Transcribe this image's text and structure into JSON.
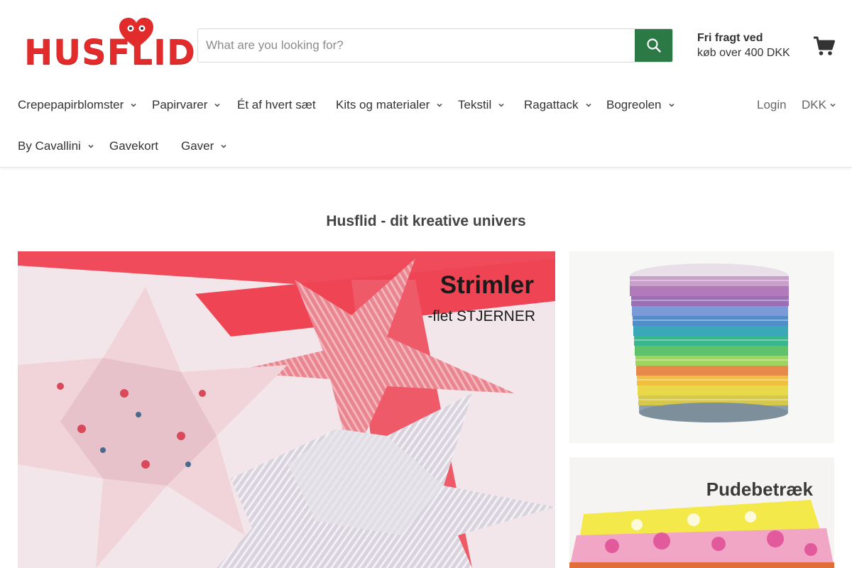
{
  "brand": {
    "logo_text": "HUSFLID",
    "colors": {
      "logo_red": "#e22b2b",
      "accent_green": "#2b7a45"
    }
  },
  "search": {
    "placeholder": "What are you looking for?",
    "value": "",
    "icon": "search-icon"
  },
  "shipping": {
    "title": "Fri fragt ved",
    "subtitle": "køb over 400 DKK"
  },
  "cart": {
    "icon": "cart-icon"
  },
  "nav": {
    "row1": [
      {
        "label": "Crepepapirblomster",
        "has_dropdown": true
      },
      {
        "label": "Papirvarer",
        "has_dropdown": true
      },
      {
        "label": "Ét af hvert sæt",
        "has_dropdown": false
      },
      {
        "label": "Kits og materialer",
        "has_dropdown": true
      },
      {
        "label": "Tekstil",
        "has_dropdown": true
      },
      {
        "label": "Ragattack",
        "has_dropdown": true
      },
      {
        "label": "Bogreolen",
        "has_dropdown": true
      }
    ],
    "row2": [
      {
        "label": "By Cavallini",
        "has_dropdown": true
      },
      {
        "label": "Gavekort",
        "has_dropdown": false
      },
      {
        "label": "Gaver",
        "has_dropdown": true
      }
    ],
    "login": "Login",
    "currency": "DKK"
  },
  "main": {
    "section_title": "Husflid - dit kreative univers",
    "hero": {
      "title": "Strimler",
      "subtitle": "-flet STJERNER"
    },
    "side2": {
      "title": "Pudebetræk"
    }
  }
}
